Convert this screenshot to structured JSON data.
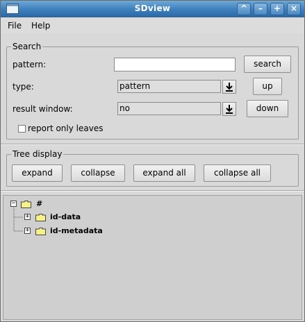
{
  "window": {
    "title": "SDview"
  },
  "titlebar_buttons": [
    "^",
    "–",
    "+",
    "×"
  ],
  "menu": {
    "items": [
      "File",
      "Help"
    ]
  },
  "search": {
    "group_title": "Search",
    "pattern_label": "pattern:",
    "pattern_value": "",
    "search_button": "search",
    "type_label": "type:",
    "type_value": "pattern",
    "up_button": "up",
    "result_label": "result window:",
    "result_value": "no",
    "down_button": "down",
    "report_leaves_label": "report only leaves",
    "report_leaves_checked": false
  },
  "tree_display": {
    "group_title": "Tree display",
    "buttons": [
      "expand",
      "collapse",
      "expand all",
      "collapse all"
    ]
  },
  "tree": {
    "root": {
      "label": "#",
      "state": "expanded"
    },
    "children": [
      {
        "label": "id-data",
        "state": "collapsed"
      },
      {
        "label": "id-metadata",
        "state": "collapsed"
      }
    ]
  },
  "colors": {
    "titlebar": "#3d7fbd",
    "folder": "#f7f18a",
    "tree_bg": "#cfcfcf"
  }
}
